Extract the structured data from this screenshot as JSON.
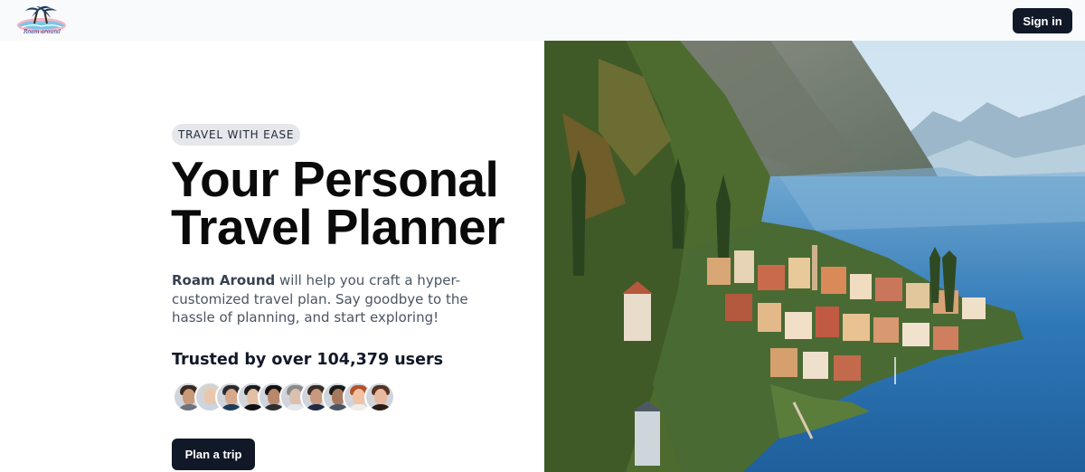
{
  "header": {
    "logo_text": "Roam around",
    "signin_label": "Sign in"
  },
  "hero": {
    "badge": "TRAVEL WITH EASE",
    "title_line1": "Your Personal",
    "title_line2": "Travel Planner",
    "brand_name": "Roam Around",
    "description": " will help you craft a hyper-customized travel plan. Say goodbye to the hassle of planning, and start exploring!",
    "trusted": "Trusted by over 104,379 users",
    "cta_label": "Plan a trip"
  },
  "avatars": [
    {
      "skin": "#c89a7a",
      "hair": "#3b2a20",
      "shirt": "#6b7280"
    },
    {
      "skin": "#e9c7ae",
      "hair": "#d9d2c4",
      "shirt": "#cbd5e1"
    },
    {
      "skin": "#d6a98b",
      "hair": "#2b2b2b",
      "shirt": "#1f3b5a"
    },
    {
      "skin": "#e4bfa3",
      "hair": "#1c1c1c",
      "shirt": "#111111"
    },
    {
      "skin": "#b9876a",
      "hair": "#121212",
      "shirt": "#2d2d2d"
    },
    {
      "skin": "#dcc0ae",
      "hair": "#8a8a8a",
      "shirt": "#e5e7eb"
    },
    {
      "skin": "#c79a80",
      "hair": "#3a2c22",
      "shirt": "#1e2a44"
    },
    {
      "skin": "#a8785e",
      "hair": "#1a1a1a",
      "shirt": "#4b5563"
    },
    {
      "skin": "#f0c2a6",
      "hair": "#b4532a",
      "shirt": "#f3ede6"
    },
    {
      "skin": "#e7b9a0",
      "hair": "#5a3322",
      "shirt": "#2b1d17"
    }
  ],
  "colors": {
    "dark_button": "#111827",
    "badge_bg": "#e5e7eb",
    "header_bg": "#f9fafb",
    "lake": "#2f78b8",
    "sky": "#cfe3f1"
  },
  "icons": {
    "logo": "palm-island-logo"
  }
}
